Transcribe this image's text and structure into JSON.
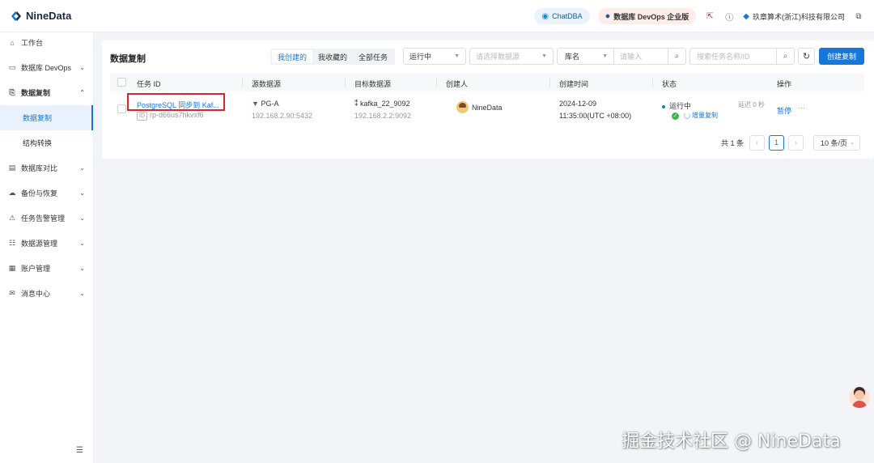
{
  "app": {
    "logo_text": "NineData",
    "chat_label": "ChatDBA",
    "edition_label": "数据库 DevOps 企业版",
    "company": "玖章算术(浙江)科技有限公司"
  },
  "sidebar": {
    "items": [
      {
        "label": "工作台",
        "icon": "home-icon"
      },
      {
        "label": "数据库 DevOps",
        "icon": "terminal-icon"
      },
      {
        "label": "数据复制",
        "icon": "copy-icon"
      },
      {
        "label": "数据复制"
      },
      {
        "label": "结构转换"
      },
      {
        "label": "数据库对比",
        "icon": "compare-icon"
      },
      {
        "label": "备份与恢复",
        "icon": "cloud-icon"
      },
      {
        "label": "任务告警管理",
        "icon": "alarm-icon"
      },
      {
        "label": "数据源管理",
        "icon": "database-icon"
      },
      {
        "label": "账户管理",
        "icon": "account-icon"
      },
      {
        "label": "消息中心",
        "icon": "mail-icon"
      }
    ]
  },
  "page": {
    "title": "数据复制",
    "filter_tabs": [
      "我创建的",
      "我收藏的",
      "全部任务"
    ],
    "active_tab": "我创建的",
    "status_select": "运行中",
    "datasource_placeholder": "请选择数据源",
    "dbname_select": "库名",
    "dbname_placeholder": "请输入",
    "taskname_placeholder": "搜索任务名称/ID",
    "create_button": "创建复制"
  },
  "table": {
    "headers": [
      "任务 ID",
      "源数据源",
      "目标数据源",
      "创建人",
      "创建时间",
      "状态",
      "操作"
    ],
    "rows": [
      {
        "task_name": "PostgreSQL 同步到 Kaf...",
        "task_id_badge": "ID",
        "task_id": "rp-d66us7hkvxf6",
        "source_name": "PG-A",
        "source_addr": "192.168.2.90:5432",
        "target_name": "kafka_22_9092",
        "target_addr": "192.168.2.2:9092",
        "creator": "NineData",
        "created_date": "2024-12-09",
        "created_time": "11:35:00(UTC +08:00)",
        "status": "运行中",
        "delay": "延迟 0 秒",
        "phase": "增量复制",
        "action_pause": "暂停",
        "action_more": "···"
      }
    ]
  },
  "pagination": {
    "total": "共 1 条",
    "current_page": "1",
    "page_size": "10 条/页"
  },
  "watermark": "掘金技术社区 @ NineData",
  "colors": {
    "primary": "#1677d9",
    "highlight": "#d9262b",
    "success": "#3bb54a"
  }
}
